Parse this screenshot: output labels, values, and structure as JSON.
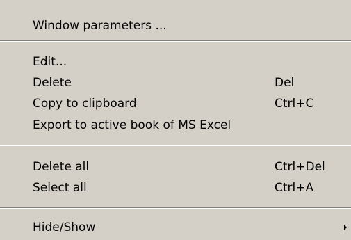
{
  "menu": {
    "items": [
      {
        "label": "Window parameters ...",
        "shortcut": ""
      },
      {
        "label": "Edit...",
        "shortcut": ""
      },
      {
        "label": "Delete",
        "shortcut": "Del"
      },
      {
        "label": "Copy to clipboard",
        "shortcut": "Ctrl+C"
      },
      {
        "label": "Export to active  book of MS Excel",
        "shortcut": ""
      },
      {
        "label": "Delete all",
        "shortcut": "Ctrl+Del"
      },
      {
        "label": "Select all",
        "shortcut": "Ctrl+A"
      },
      {
        "label": "Hide/Show",
        "shortcut": "",
        "submenu_icon": "chevron-right-icon"
      }
    ]
  },
  "colors": {
    "menu_background": "#d4d0c8",
    "text": "#000000",
    "separator_shadow": "#808080",
    "separator_highlight": "#ffffff"
  }
}
